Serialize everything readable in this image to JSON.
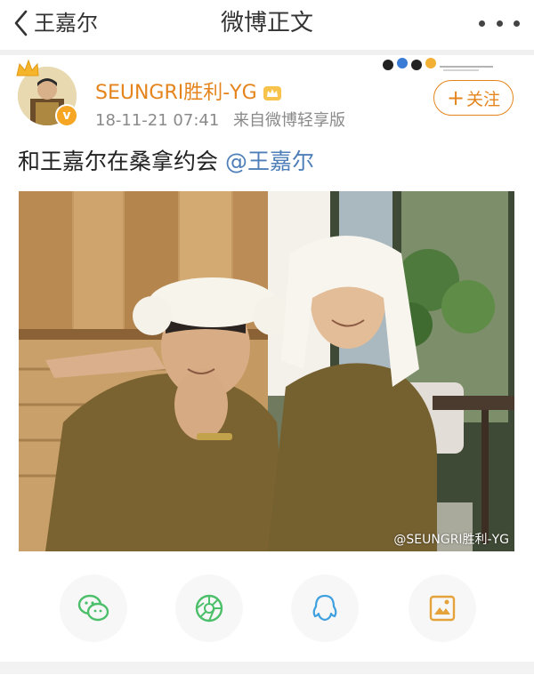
{
  "nav": {
    "back_label": "王嘉尔",
    "title": "微博正文"
  },
  "post": {
    "username": "SEUNGRI胜利-YG",
    "time": "18-11-21 07:41",
    "source": "来自微博轻享版",
    "follow_label": "关注",
    "text_plain": "和王嘉尔在桑拿约会",
    "mention": "@王嘉尔",
    "watermark": "@SEUNGRI胜利-YG"
  },
  "share_targets": [
    "wechat-icon",
    "moments-icon",
    "qq-icon",
    "save-image-icon"
  ],
  "colors": {
    "accent": "#e5841c",
    "mention": "#4f7fb8",
    "wechat": "#4cbf6a",
    "qq": "#3fa0e0",
    "save": "#e5a23a"
  }
}
